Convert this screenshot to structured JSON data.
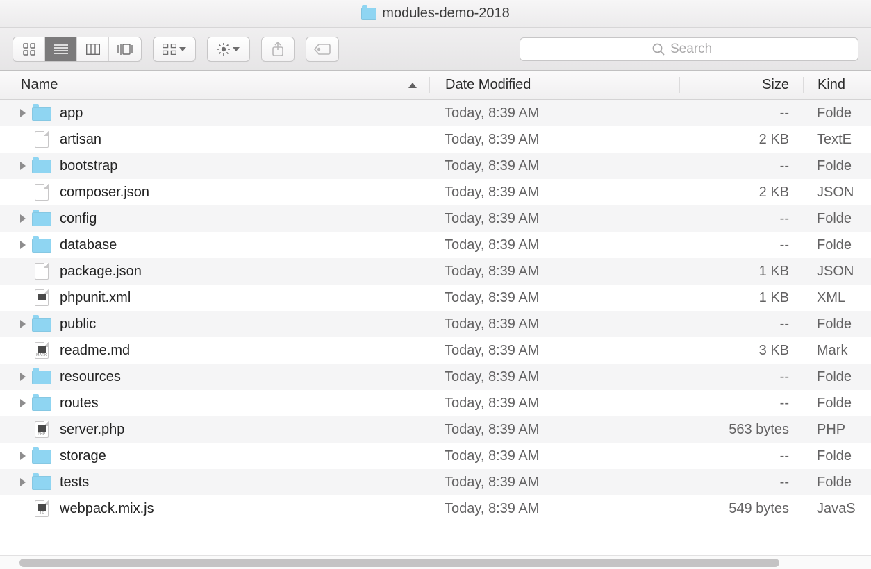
{
  "window": {
    "title": "modules-demo-2018"
  },
  "toolbar": {
    "search_placeholder": "Search"
  },
  "columns": {
    "name": "Name",
    "date": "Date Modified",
    "size": "Size",
    "kind": "Kind"
  },
  "rows": [
    {
      "name": "app",
      "date": "Today, 8:39 AM",
      "size": "--",
      "kind": "Folde",
      "type": "folder"
    },
    {
      "name": "artisan",
      "date": "Today, 8:39 AM",
      "size": "2 KB",
      "kind": "TextE",
      "type": "file"
    },
    {
      "name": "bootstrap",
      "date": "Today, 8:39 AM",
      "size": "--",
      "kind": "Folde",
      "type": "folder"
    },
    {
      "name": "composer.json",
      "date": "Today, 8:39 AM",
      "size": "2 KB",
      "kind": "JSON",
      "type": "file"
    },
    {
      "name": "config",
      "date": "Today, 8:39 AM",
      "size": "--",
      "kind": "Folde",
      "type": "folder"
    },
    {
      "name": "database",
      "date": "Today, 8:39 AM",
      "size": "--",
      "kind": "Folde",
      "type": "folder"
    },
    {
      "name": "package.json",
      "date": "Today, 8:39 AM",
      "size": "1 KB",
      "kind": "JSON",
      "type": "file"
    },
    {
      "name": "phpunit.xml",
      "date": "Today, 8:39 AM",
      "size": "1 KB",
      "kind": "XML",
      "type": "file",
      "dark": true
    },
    {
      "name": "public",
      "date": "Today, 8:39 AM",
      "size": "--",
      "kind": "Folde",
      "type": "folder"
    },
    {
      "name": "readme.md",
      "date": "Today, 8:39 AM",
      "size": "3 KB",
      "kind": "Mark",
      "type": "file",
      "dark": true,
      "tag": "MARK"
    },
    {
      "name": "resources",
      "date": "Today, 8:39 AM",
      "size": "--",
      "kind": "Folde",
      "type": "folder"
    },
    {
      "name": "routes",
      "date": "Today, 8:39 AM",
      "size": "--",
      "kind": "Folde",
      "type": "folder"
    },
    {
      "name": "server.php",
      "date": "Today, 8:39 AM",
      "size": "563 bytes",
      "kind": "PHP",
      "type": "file",
      "dark": true,
      "tag": "PHP"
    },
    {
      "name": "storage",
      "date": "Today, 8:39 AM",
      "size": "--",
      "kind": "Folde",
      "type": "folder"
    },
    {
      "name": "tests",
      "date": "Today, 8:39 AM",
      "size": "--",
      "kind": "Folde",
      "type": "folder"
    },
    {
      "name": "webpack.mix.js",
      "date": "Today, 8:39 AM",
      "size": "549 bytes",
      "kind": "JavaS",
      "type": "file",
      "dark": true,
      "tag": "JS"
    }
  ]
}
